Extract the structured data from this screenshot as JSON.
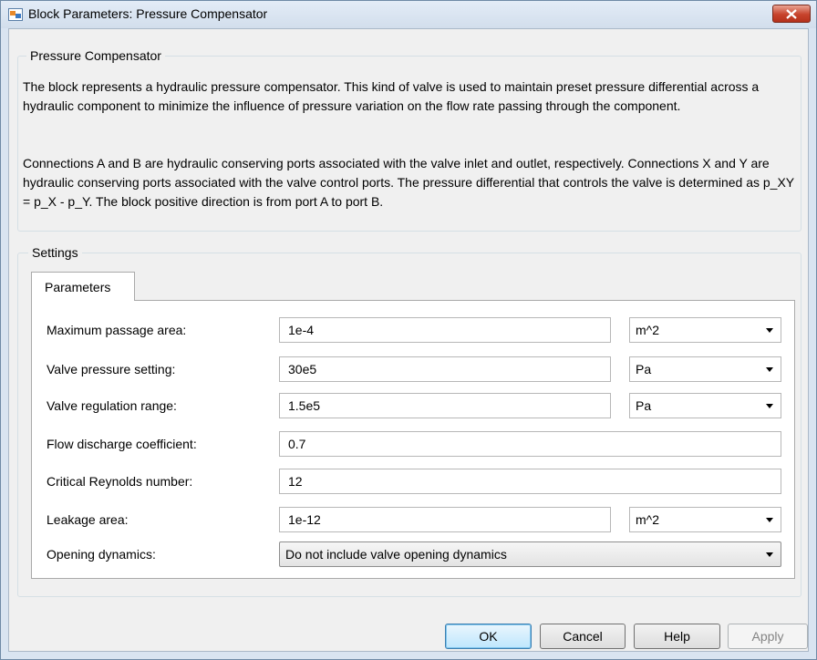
{
  "window": {
    "title": "Block Parameters: Pressure Compensator"
  },
  "description": {
    "group_title": "Pressure Compensator",
    "paragraph1": "The block represents a hydraulic pressure compensator. This kind of valve is used to maintain preset pressure differential across a hydraulic component to minimize the influence of pressure variation on the flow rate passing through the component.",
    "paragraph2": "Connections A and B are hydraulic conserving ports associated with the valve inlet and outlet, respectively. Connections X and Y are hydraulic conserving ports associated with the valve control ports. The pressure differential that controls the valve is determined as  p_XY = p_X - p_Y. The block positive direction is from port A to port B."
  },
  "settings": {
    "group_title": "Settings",
    "tab_label": "Parameters",
    "params": [
      {
        "label": "Maximum passage area:",
        "value": "1e-4",
        "unit": "m^2"
      },
      {
        "label": "Valve pressure setting:",
        "value": "30e5",
        "unit": "Pa"
      },
      {
        "label": "Valve regulation range:",
        "value": "1.5e5",
        "unit": "Pa"
      },
      {
        "label": "Flow discharge coefficient:",
        "value": "0.7"
      },
      {
        "label": "Critical Reynolds number:",
        "value": "12"
      },
      {
        "label": "Leakage area:",
        "value": "1e-12",
        "unit": "m^2"
      },
      {
        "label": "Opening dynamics:",
        "selected": "Do not include valve opening dynamics"
      }
    ]
  },
  "buttons": {
    "ok": "OK",
    "cancel": "Cancel",
    "help": "Help",
    "apply": "Apply"
  },
  "icons": {
    "app": "simulink-block-icon",
    "close": "close-icon",
    "dropdown": "chevron-down-icon"
  },
  "colors": {
    "close_button": "#c7432c",
    "default_button_border": "#3c7fb1"
  }
}
